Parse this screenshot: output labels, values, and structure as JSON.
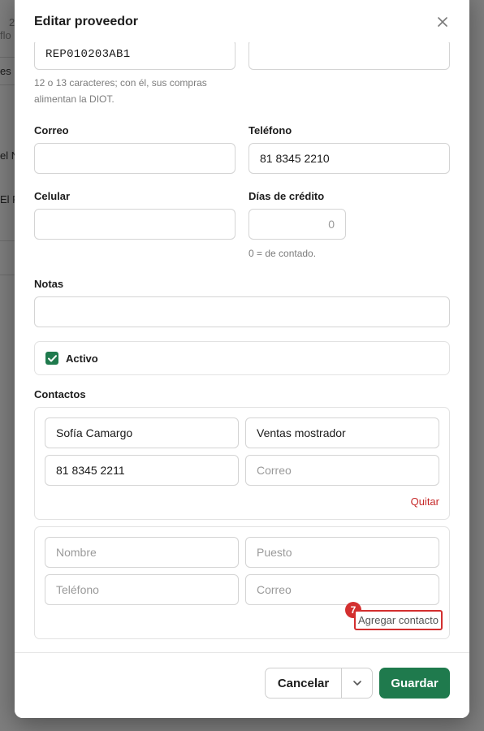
{
  "background": {
    "fragments": [
      "2",
      "flo",
      "es",
      "el N",
      "El P"
    ]
  },
  "modal": {
    "title": "Editar proveedor",
    "close_icon": "close-icon"
  },
  "form": {
    "rfc": {
      "value": "REP010203AB1",
      "help_line1": "12 o 13 caracteres; con él, sus compras",
      "help_line2": "alimentan la DIOT."
    },
    "email": {
      "label": "Correo",
      "value": ""
    },
    "phone": {
      "label": "Teléfono",
      "value": "81 8345 2210"
    },
    "mobile": {
      "label": "Celular",
      "value": ""
    },
    "credit_days": {
      "label": "Días de crédito",
      "value": "0",
      "help": "0 = de contado."
    },
    "notes": {
      "label": "Notas",
      "value": ""
    },
    "active": {
      "label": "Activo",
      "checked": true
    }
  },
  "contacts": {
    "label": "Contactos",
    "existing": {
      "name": "Sofía Camargo",
      "position": "Ventas mostrador",
      "phone": "81 8345 2211",
      "email_placeholder": "Correo",
      "remove_label": "Quitar"
    },
    "new": {
      "name_placeholder": "Nombre",
      "position_placeholder": "Puesto",
      "phone_placeholder": "Teléfono",
      "email_placeholder": "Correo",
      "add_label": "Agregar contacto",
      "badge": "7"
    }
  },
  "footer": {
    "cancel_label": "Cancelar",
    "save_label": "Guardar"
  },
  "colors": {
    "primary": "#1f7a4d",
    "danger": "#c62a2a",
    "highlight": "#d32f2f"
  }
}
